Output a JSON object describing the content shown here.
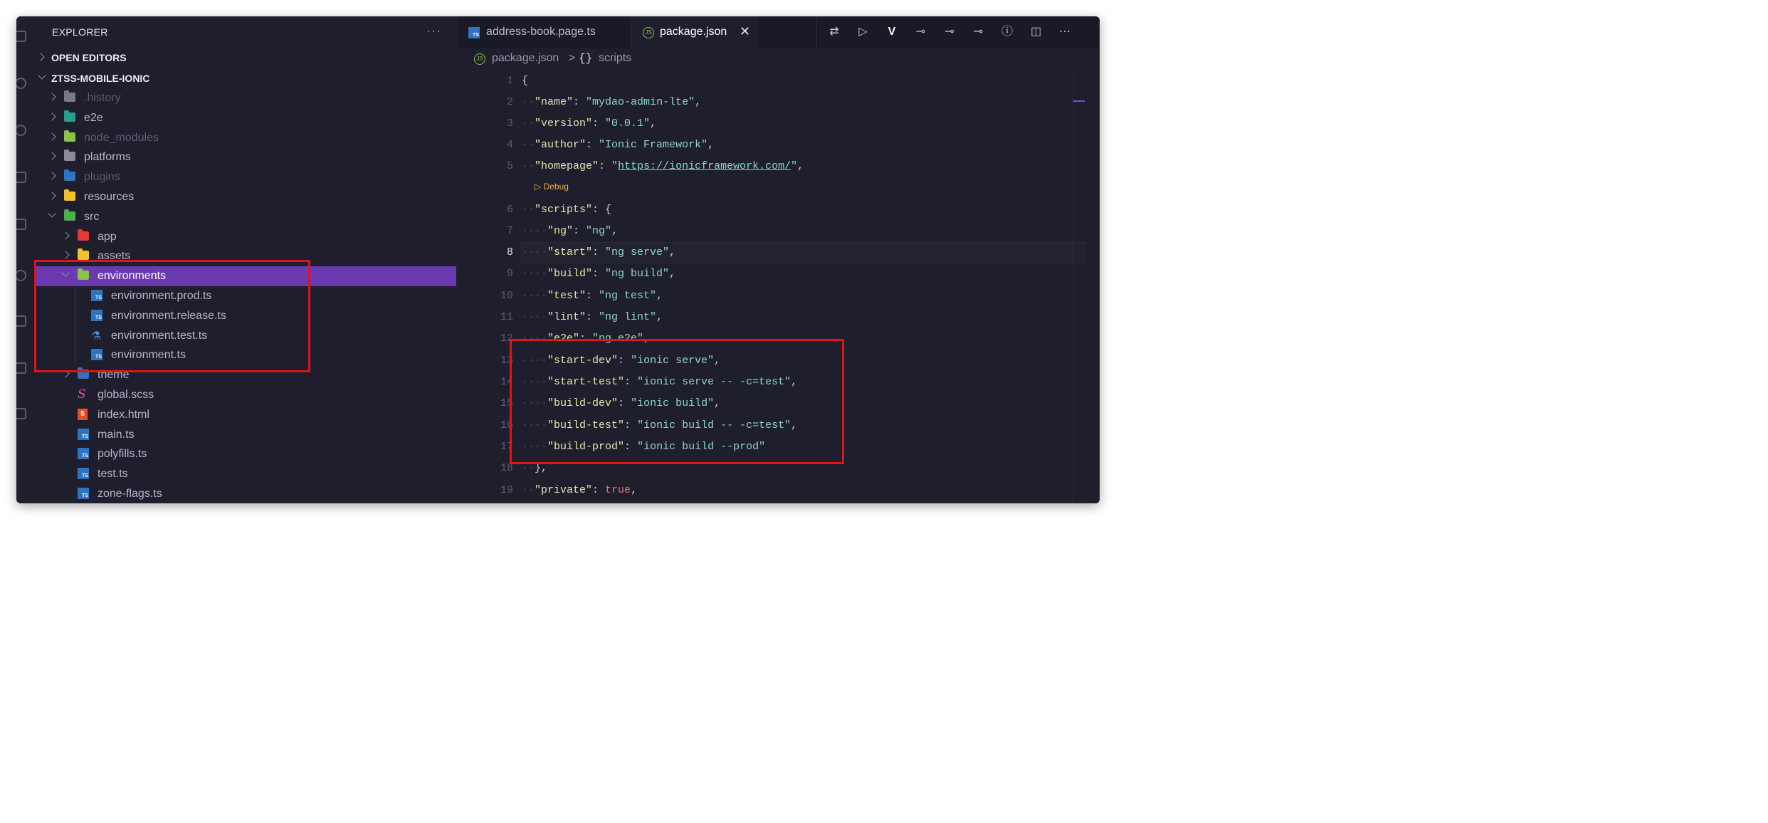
{
  "sidebar": {
    "header": "EXPLORER",
    "more_icon": "more-horizontal-icon",
    "sections": {
      "open_editors": "OPEN EDITORS",
      "project": "ZTSS-MOBILE-IONIC"
    },
    "tree": [
      {
        "label": ".history",
        "kind": "folder",
        "depth": 1,
        "expanded": false,
        "dim": true,
        "color": "#7a7a8a"
      },
      {
        "label": "e2e",
        "kind": "folder",
        "depth": 1,
        "expanded": false,
        "dim": false,
        "color": "#2a9d8f"
      },
      {
        "label": "node_modules",
        "kind": "folder",
        "depth": 1,
        "expanded": false,
        "dim": true,
        "color": "#8bc34a"
      },
      {
        "label": "platforms",
        "kind": "folder",
        "depth": 1,
        "expanded": false,
        "dim": false,
        "color": "#8a8a9a"
      },
      {
        "label": "plugins",
        "kind": "folder",
        "depth": 1,
        "expanded": false,
        "dim": true,
        "color": "#2f74c0"
      },
      {
        "label": "resources",
        "kind": "folder",
        "depth": 1,
        "expanded": false,
        "dim": false,
        "color": "#f2c12e"
      },
      {
        "label": "src",
        "kind": "folder",
        "depth": 1,
        "expanded": true,
        "dim": false,
        "color": "#4caf50"
      },
      {
        "label": "app",
        "kind": "folder",
        "depth": 2,
        "expanded": false,
        "dim": false,
        "color": "#e53935"
      },
      {
        "label": "assets",
        "kind": "folder",
        "depth": 2,
        "expanded": false,
        "dim": false,
        "color": "#f2c12e"
      },
      {
        "label": "environments",
        "kind": "folder",
        "depth": 2,
        "expanded": true,
        "dim": false,
        "selected": true,
        "color": "#8bc34a"
      },
      {
        "label": "environment.prod.ts",
        "kind": "ts",
        "depth": 3
      },
      {
        "label": "environment.release.ts",
        "kind": "ts",
        "depth": 3
      },
      {
        "label": "environment.test.ts",
        "kind": "test",
        "depth": 3
      },
      {
        "label": "environment.ts",
        "kind": "ts",
        "depth": 3
      },
      {
        "label": "theme",
        "kind": "folder",
        "depth": 2,
        "expanded": false,
        "dim": false,
        "color": "#2f74c0"
      },
      {
        "label": "global.scss",
        "kind": "scss",
        "depth": 2
      },
      {
        "label": "index.html",
        "kind": "html",
        "depth": 2
      },
      {
        "label": "main.ts",
        "kind": "ts",
        "depth": 2
      },
      {
        "label": "polyfills.ts",
        "kind": "ts",
        "depth": 2
      },
      {
        "label": "test.ts",
        "kind": "ts",
        "depth": 2
      },
      {
        "label": "zone-flags.ts",
        "kind": "ts",
        "depth": 2
      }
    ]
  },
  "editor": {
    "tabs": [
      {
        "label": "address-book.page.ts",
        "icon": "typescript-file-icon",
        "active": false
      },
      {
        "label": "package.json",
        "icon": "json-file-icon",
        "active": true
      }
    ],
    "toolbar": [
      {
        "name": "compare-changes-icon",
        "glyph": "⇄"
      },
      {
        "name": "run-icon",
        "glyph": "▷"
      },
      {
        "name": "vue-icon",
        "glyph": "V"
      },
      {
        "name": "git-commit-icon",
        "glyph": "⊸"
      },
      {
        "name": "git-commit-prev-icon",
        "glyph": "⊸"
      },
      {
        "name": "git-commit-next-icon",
        "glyph": "⊸"
      },
      {
        "name": "timeline-icon",
        "glyph": "ⓘ"
      },
      {
        "name": "split-editor-icon",
        "glyph": "◫"
      },
      {
        "name": "more-actions-icon",
        "glyph": "⋯"
      }
    ],
    "breadcrumb": {
      "file": "package.json",
      "separator": ">",
      "symbol_icon": "{}",
      "symbol": "scripts"
    },
    "debug_lens": "Debug",
    "current_line": 8,
    "lines": [
      {
        "n": "1",
        "indent": 0,
        "tokens": [
          {
            "t": "{",
            "c": "p"
          }
        ]
      },
      {
        "n": "2",
        "indent": 1,
        "tokens": [
          {
            "t": "\"name\"",
            "c": "k"
          },
          {
            "t": ": ",
            "c": "p"
          },
          {
            "t": "\"mydao-admin-lte\"",
            "c": "s"
          },
          {
            "t": ",",
            "c": "p"
          }
        ]
      },
      {
        "n": "3",
        "indent": 1,
        "tokens": [
          {
            "t": "\"version\"",
            "c": "k"
          },
          {
            "t": ": ",
            "c": "p"
          },
          {
            "t": "\"0.0.1\"",
            "c": "s"
          },
          {
            "t": ",",
            "c": "p"
          }
        ]
      },
      {
        "n": "4",
        "indent": 1,
        "tokens": [
          {
            "t": "\"author\"",
            "c": "k"
          },
          {
            "t": ": ",
            "c": "p"
          },
          {
            "t": "\"Ionic Framework\"",
            "c": "s"
          },
          {
            "t": ",",
            "c": "p"
          }
        ]
      },
      {
        "n": "5",
        "indent": 1,
        "tokens": [
          {
            "t": "\"homepage\"",
            "c": "k"
          },
          {
            "t": ": ",
            "c": "p"
          },
          {
            "t": "\"",
            "c": "s"
          },
          {
            "t": "https://ionicframework.com/",
            "c": "s link"
          },
          {
            "t": "\"",
            "c": "s"
          },
          {
            "t": ",",
            "c": "p"
          }
        ]
      },
      {
        "n": "6",
        "indent": 1,
        "tokens": [
          {
            "t": "\"scripts\"",
            "c": "k"
          },
          {
            "t": ": ",
            "c": "p"
          },
          {
            "t": "{",
            "c": "p"
          }
        ]
      },
      {
        "n": "7",
        "indent": 2,
        "tokens": [
          {
            "t": "\"ng\"",
            "c": "k"
          },
          {
            "t": ": ",
            "c": "p"
          },
          {
            "t": "\"ng\"",
            "c": "s"
          },
          {
            "t": ",",
            "c": "p"
          }
        ]
      },
      {
        "n": "8",
        "indent": 2,
        "tokens": [
          {
            "t": "\"start\"",
            "c": "k"
          },
          {
            "t": ": ",
            "c": "p"
          },
          {
            "t": "\"ng serve\"",
            "c": "s"
          },
          {
            "t": ",",
            "c": "p"
          }
        ]
      },
      {
        "n": "9",
        "indent": 2,
        "tokens": [
          {
            "t": "\"build\"",
            "c": "k"
          },
          {
            "t": ": ",
            "c": "p"
          },
          {
            "t": "\"ng build\"",
            "c": "s"
          },
          {
            "t": ",",
            "c": "p"
          }
        ]
      },
      {
        "n": "10",
        "indent": 2,
        "tokens": [
          {
            "t": "\"test\"",
            "c": "k"
          },
          {
            "t": ": ",
            "c": "p"
          },
          {
            "t": "\"ng test\"",
            "c": "s"
          },
          {
            "t": ",",
            "c": "p"
          }
        ]
      },
      {
        "n": "11",
        "indent": 2,
        "tokens": [
          {
            "t": "\"lint\"",
            "c": "k"
          },
          {
            "t": ": ",
            "c": "p"
          },
          {
            "t": "\"ng lint\"",
            "c": "s"
          },
          {
            "t": ",",
            "c": "p"
          }
        ]
      },
      {
        "n": "12",
        "indent": 2,
        "tokens": [
          {
            "t": "\"e2e\"",
            "c": "k"
          },
          {
            "t": ": ",
            "c": "p"
          },
          {
            "t": "\"ng e2e\"",
            "c": "s"
          },
          {
            "t": ",",
            "c": "p"
          }
        ]
      },
      {
        "n": "13",
        "indent": 2,
        "tokens": [
          {
            "t": "\"start-dev\"",
            "c": "k"
          },
          {
            "t": ": ",
            "c": "p"
          },
          {
            "t": "\"ionic serve\"",
            "c": "s"
          },
          {
            "t": ",",
            "c": "p"
          }
        ]
      },
      {
        "n": "14",
        "indent": 2,
        "tokens": [
          {
            "t": "\"start-test\"",
            "c": "k"
          },
          {
            "t": ": ",
            "c": "p"
          },
          {
            "t": "\"ionic serve -- -c=test\"",
            "c": "s"
          },
          {
            "t": ",",
            "c": "p"
          }
        ]
      },
      {
        "n": "15",
        "indent": 2,
        "tokens": [
          {
            "t": "\"build-dev\"",
            "c": "k"
          },
          {
            "t": ": ",
            "c": "p"
          },
          {
            "t": "\"ionic build\"",
            "c": "s"
          },
          {
            "t": ",",
            "c": "p"
          }
        ]
      },
      {
        "n": "16",
        "indent": 2,
        "tokens": [
          {
            "t": "\"build-test\"",
            "c": "k"
          },
          {
            "t": ": ",
            "c": "p"
          },
          {
            "t": "\"ionic build -- -c=test\"",
            "c": "s"
          },
          {
            "t": ",",
            "c": "p"
          }
        ]
      },
      {
        "n": "17",
        "indent": 2,
        "tokens": [
          {
            "t": "\"build-prod\"",
            "c": "k"
          },
          {
            "t": ": ",
            "c": "p"
          },
          {
            "t": "\"ionic build --prod\"",
            "c": "s"
          }
        ]
      },
      {
        "n": "18",
        "indent": 1,
        "tokens": [
          {
            "t": "}",
            "c": "p"
          },
          {
            "t": ",",
            "c": "p"
          }
        ]
      },
      {
        "n": "19",
        "indent": 1,
        "tokens": [
          {
            "t": "\"private\"",
            "c": "k"
          },
          {
            "t": ": ",
            "c": "p"
          },
          {
            "t": "true",
            "c": "t"
          },
          {
            "t": ",",
            "c": "p"
          }
        ]
      }
    ]
  },
  "colors": {
    "selection": "#6a3ab2",
    "annotation": "#e01515",
    "json_key": "#e6e6ae",
    "json_string": "#8fd7c2",
    "json_bool": "#f06a74"
  }
}
